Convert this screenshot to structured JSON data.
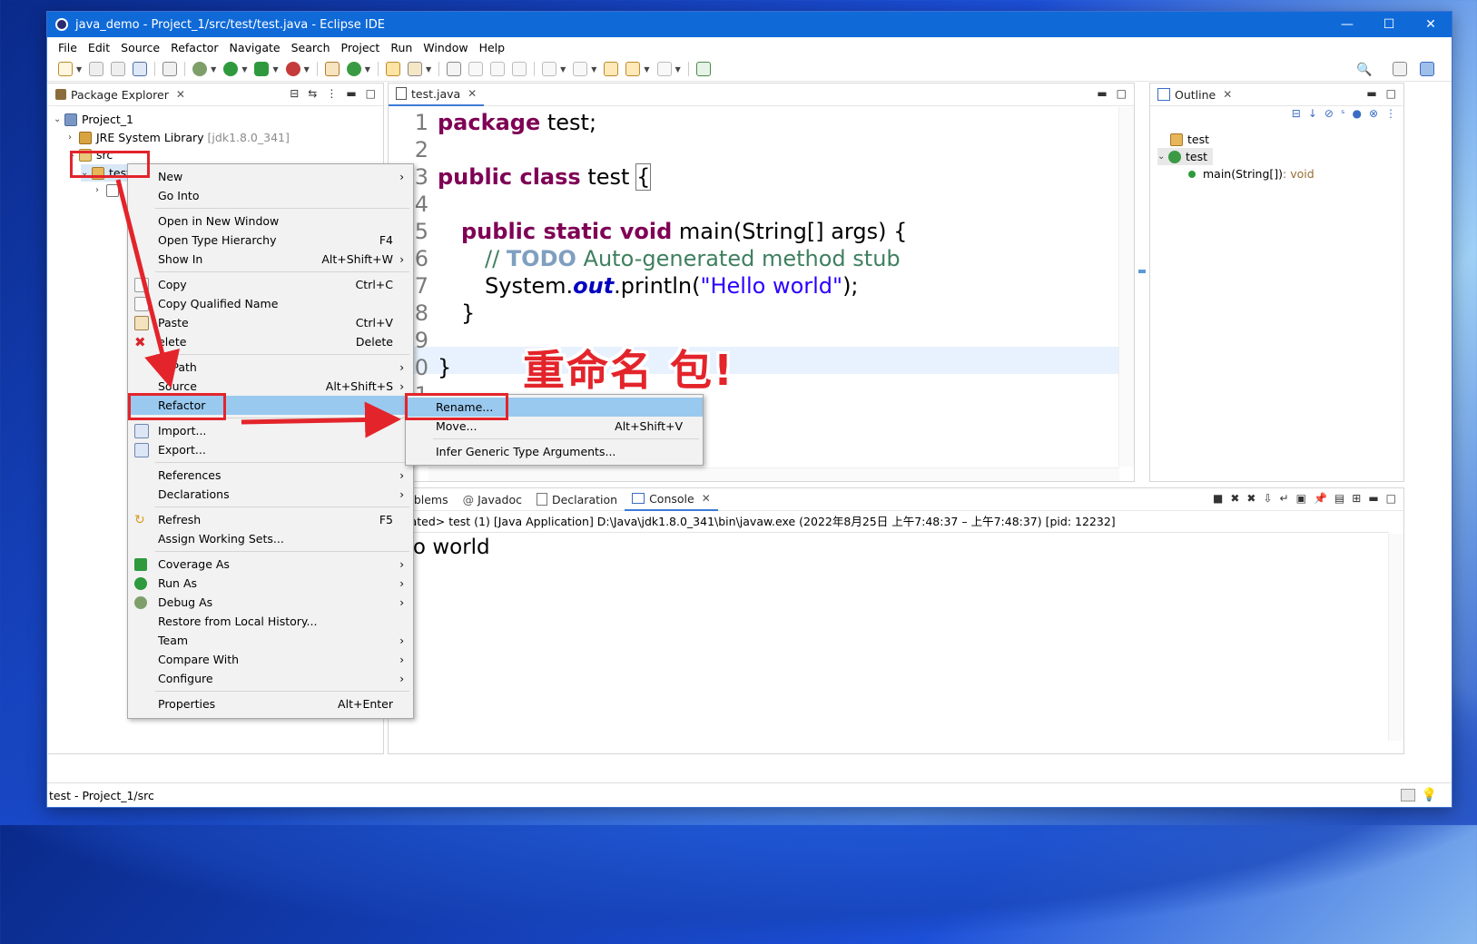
{
  "window": {
    "title": "java_demo - Project_1/src/test/test.java - Eclipse IDE",
    "min": "—",
    "max": "☐",
    "close": "✕"
  },
  "menu": [
    "File",
    "Edit",
    "Source",
    "Refactor",
    "Navigate",
    "Search",
    "Project",
    "Run",
    "Window",
    "Help"
  ],
  "package_explorer": {
    "title": "Package Explorer",
    "rows": [
      {
        "label": "Project_1"
      },
      {
        "label": "JRE System Library",
        "extra": "[jdk1.8.0_341]"
      },
      {
        "label": "src"
      },
      {
        "label": "test"
      }
    ]
  },
  "editor": {
    "tab": "test.java",
    "line_numbers": [
      "1",
      "2",
      "3",
      "4",
      "5",
      "6",
      "7",
      "8",
      "9",
      "0",
      "1"
    ],
    "lines": {
      "l1_kw": "package",
      "l1_rest": " test;",
      "l3_kw": "public class",
      "l3_rest": " test ",
      "l3_brace": "{",
      "l5_kw": "public static void",
      "l5_rest": " main(String[] args) {",
      "l6_cm1": "// ",
      "l6_todo": "TODO",
      "l6_cm2": " Auto-generated method stub",
      "l7_a": "System.",
      "l7_field": "out",
      "l7_b": ".println(",
      "l7_str": "\"Hello world\"",
      "l7_c": ");",
      "l8": "}",
      "l10": "}"
    }
  },
  "outline": {
    "title": "Outline",
    "rows": [
      {
        "label": "test"
      },
      {
        "label": "test"
      },
      {
        "label": "main(String[])",
        "type": " : void"
      }
    ]
  },
  "console": {
    "tabs": [
      "Problems",
      "Javadoc",
      "Declaration",
      "Console"
    ],
    "status": "minated> test (1) [Java Application] D:\\Java\\jdk1.8.0_341\\bin\\javaw.exe  (2022年8月25日 上午7:48:37 – 上午7:48:37) [pid: 12232]",
    "output": "ello world"
  },
  "context_menu": {
    "items": [
      {
        "label": "New",
        "sc": "",
        "sub": "›"
      },
      {
        "label": "Go Into",
        "sc": "",
        "sub": ""
      },
      {
        "label": "Open in New Window",
        "sc": "",
        "sub": ""
      },
      {
        "label": "Open Type Hierarchy",
        "sc": "F4",
        "sub": ""
      },
      {
        "label": "Show In",
        "sc": "Alt+Shift+W",
        "sub": "›"
      },
      {
        "label": "Copy",
        "sc": "Ctrl+C",
        "sub": ""
      },
      {
        "label": "Copy Qualified Name",
        "sc": "",
        "sub": ""
      },
      {
        "label": "Paste",
        "sc": "Ctrl+V",
        "sub": ""
      },
      {
        "label": "elete",
        "sc": "Delete",
        "sub": ""
      },
      {
        "label": "ld Path",
        "sc": "",
        "sub": "›"
      },
      {
        "label": "Source",
        "sc": "Alt+Shift+S",
        "sub": "›"
      },
      {
        "label": "Refactor",
        "sc": "",
        "sub": ""
      },
      {
        "label": "Import...",
        "sc": "",
        "sub": ""
      },
      {
        "label": "Export...",
        "sc": "",
        "sub": ""
      },
      {
        "label": "References",
        "sc": "",
        "sub": "›"
      },
      {
        "label": "Declarations",
        "sc": "",
        "sub": "›"
      },
      {
        "label": "Refresh",
        "sc": "F5",
        "sub": ""
      },
      {
        "label": "Assign Working Sets...",
        "sc": "",
        "sub": ""
      },
      {
        "label": "Coverage As",
        "sc": "",
        "sub": "›"
      },
      {
        "label": "Run As",
        "sc": "",
        "sub": "›"
      },
      {
        "label": "Debug As",
        "sc": "",
        "sub": "›"
      },
      {
        "label": "Restore from Local History...",
        "sc": "",
        "sub": ""
      },
      {
        "label": "Team",
        "sc": "",
        "sub": "›"
      },
      {
        "label": "Compare With",
        "sc": "",
        "sub": "›"
      },
      {
        "label": "Configure",
        "sc": "",
        "sub": "›"
      },
      {
        "label": "Properties",
        "sc": "Alt+Enter",
        "sub": ""
      }
    ]
  },
  "refactor_submenu": {
    "items": [
      {
        "label": "Rename...",
        "sc": ""
      },
      {
        "label": "Move...",
        "sc": "Alt+Shift+V"
      },
      {
        "label": "Infer Generic Type Arguments...",
        "sc": ""
      }
    ]
  },
  "annotation": {
    "text": "重命名 包!",
    "color": "#e3242b"
  },
  "statusbar": {
    "text": "test - Project_1/src"
  }
}
